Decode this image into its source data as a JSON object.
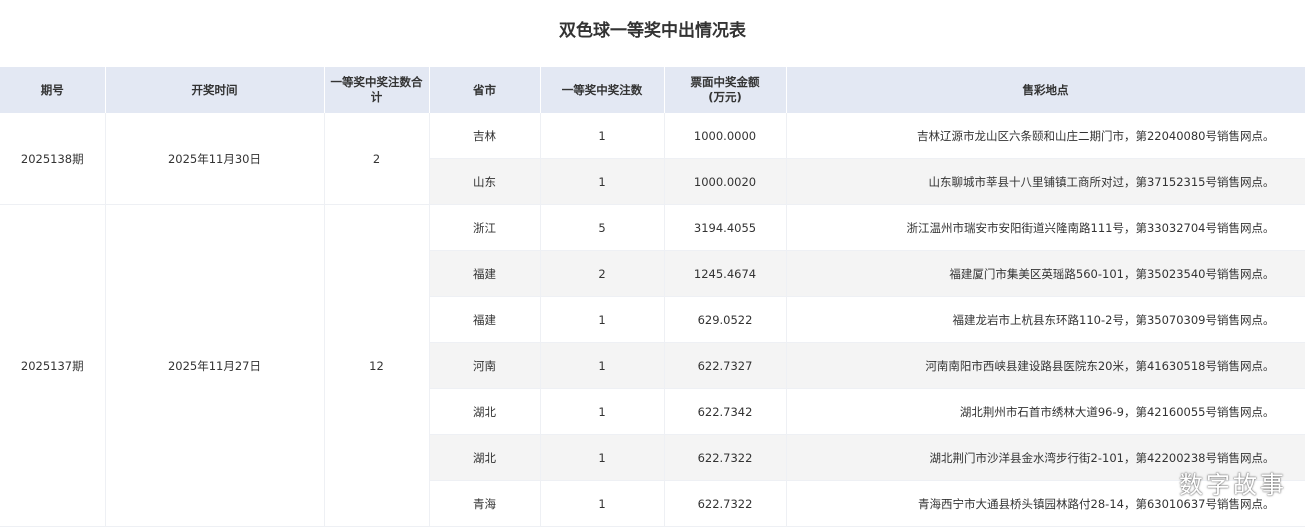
{
  "title": "双色球一等奖中出情况表",
  "columns": [
    "期号",
    "开奖时间",
    "一等奖中奖注数合计",
    "省市",
    "一等奖中奖注数",
    "票面中奖金额\n(万元)",
    "售彩地点"
  ],
  "groups": [
    {
      "issue": "2025138期",
      "date": "2025年11月30日",
      "total": "2",
      "rows": [
        {
          "province": "吉林",
          "count": "1",
          "amount": "1000.0000",
          "location": "吉林辽源市龙山区六条颐和山庄二期门市，第22040080号销售网点。"
        },
        {
          "province": "山东",
          "count": "1",
          "amount": "1000.0020",
          "location": "山东聊城市莘县十八里铺镇工商所对过，第37152315号销售网点。"
        }
      ]
    },
    {
      "issue": "2025137期",
      "date": "2025年11月27日",
      "total": "12",
      "rows": [
        {
          "province": "浙江",
          "count": "5",
          "amount": "3194.4055",
          "location": "浙江温州市瑞安市安阳街道兴隆南路111号，第33032704号销售网点。"
        },
        {
          "province": "福建",
          "count": "2",
          "amount": "1245.4674",
          "location": "福建厦门市集美区英瑶路560-101，第35023540号销售网点。"
        },
        {
          "province": "福建",
          "count": "1",
          "amount": "629.0522",
          "location": "福建龙岩市上杭县东环路110-2号，第35070309号销售网点。"
        },
        {
          "province": "河南",
          "count": "1",
          "amount": "622.7327",
          "location": "河南南阳市西峡县建设路县医院东20米，第41630518号销售网点。"
        },
        {
          "province": "湖北",
          "count": "1",
          "amount": "622.7342",
          "location": "湖北荆州市石首市绣林大道96-9，第42160055号销售网点。"
        },
        {
          "province": "湖北",
          "count": "1",
          "amount": "622.7322",
          "location": "湖北荆门市沙洋县金水湾步行街2-101，第42200238号销售网点。"
        },
        {
          "province": "青海",
          "count": "1",
          "amount": "622.7322",
          "location": "青海西宁市大通县桥头镇园林路付28-14，第63010637号销售网点。"
        }
      ]
    }
  ],
  "watermark": "数字故事"
}
